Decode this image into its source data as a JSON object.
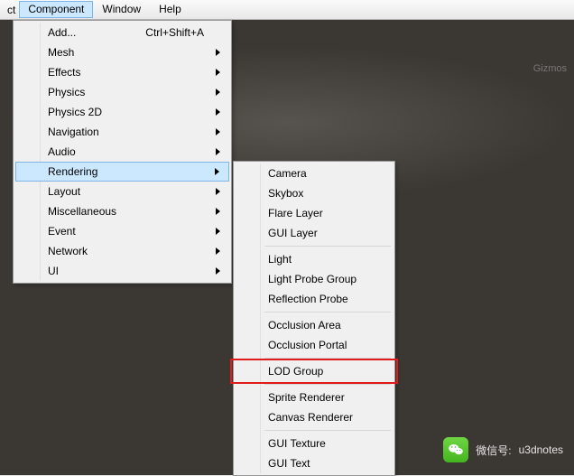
{
  "menubar": {
    "leading": "ct",
    "items": [
      {
        "label": "Component",
        "selected": true
      },
      {
        "label": "Window",
        "selected": false
      },
      {
        "label": "Help",
        "selected": false
      }
    ]
  },
  "viewport": {
    "gizmos_label": "Gizmos"
  },
  "menu_component": {
    "items": [
      {
        "label": "Add...",
        "shortcut": "Ctrl+Shift+A",
        "submenu": false
      },
      {
        "label": "Mesh",
        "submenu": true
      },
      {
        "label": "Effects",
        "submenu": true
      },
      {
        "label": "Physics",
        "submenu": true
      },
      {
        "label": "Physics 2D",
        "submenu": true
      },
      {
        "label": "Navigation",
        "submenu": true
      },
      {
        "label": "Audio",
        "submenu": true
      },
      {
        "label": "Rendering",
        "submenu": true,
        "hover": true
      },
      {
        "label": "Layout",
        "submenu": true
      },
      {
        "label": "Miscellaneous",
        "submenu": true
      },
      {
        "label": "Event",
        "submenu": true
      },
      {
        "label": "Network",
        "submenu": true
      },
      {
        "label": "UI",
        "submenu": true
      }
    ]
  },
  "menu_rendering": {
    "groups": [
      [
        {
          "label": "Camera"
        },
        {
          "label": "Skybox"
        },
        {
          "label": "Flare Layer"
        },
        {
          "label": "GUI Layer"
        }
      ],
      [
        {
          "label": "Light"
        },
        {
          "label": "Light Probe Group"
        },
        {
          "label": "Reflection Probe"
        }
      ],
      [
        {
          "label": "Occlusion Area"
        },
        {
          "label": "Occlusion Portal"
        }
      ],
      [
        {
          "label": "LOD Group",
          "highlight": true
        }
      ],
      [
        {
          "label": "Sprite Renderer"
        },
        {
          "label": "Canvas Renderer"
        }
      ],
      [
        {
          "label": "GUI Texture"
        },
        {
          "label": "GUI Text"
        }
      ]
    ]
  },
  "watermark": {
    "prefix": "微信号:",
    "id": "u3dnotes"
  },
  "colors": {
    "hover_bg": "#CCE8FF",
    "hover_border": "#7EB4E8",
    "highlight_border": "#E11B1B"
  }
}
